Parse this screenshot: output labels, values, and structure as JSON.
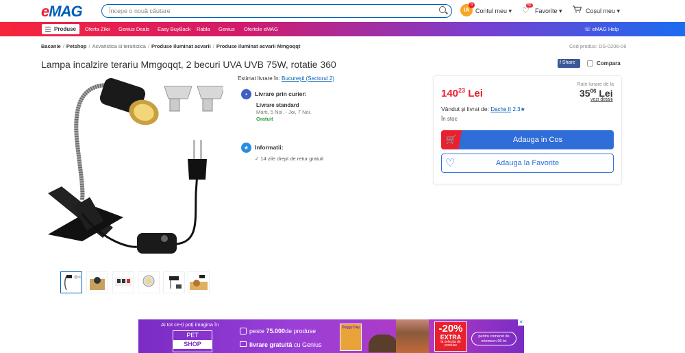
{
  "header": {
    "logo": {
      "e": "e",
      "mag": "MAG"
    },
    "search_placeholder": "Începe o nouă căutare",
    "avatar_initials": "IA",
    "avatar_badge": "8",
    "account_label": "Contul meu",
    "favorites_label": "Favorite",
    "favorites_badge": "56",
    "cart_label": "Coșul meu"
  },
  "nav": {
    "products": "Produse",
    "links": [
      "Oferta Zilei",
      "Genius Deals",
      "Easy BuyBack",
      "Rabla",
      "Genius",
      "Ofertele eMAG"
    ],
    "help": "eMAG Help"
  },
  "breadcrumb": [
    "Bacanie",
    "Petshop",
    "Acvaristica si teraristica",
    "Produse iluminat acvarii",
    "Produse iluminat acvarii Mmgoqqt"
  ],
  "product_code": "Cod produs: DS-0206-06",
  "title": "Lampa incalzire terariu Mmgoqqt, 2 becuri UVA UVB 75W, rotatie 360",
  "share": "Share",
  "compare": "Compara",
  "delivery": {
    "estim_label": "Estimat livrare în:",
    "estim_loc": "București (Sectorul 2)",
    "courier_title": "Livrare prin curier:",
    "standard": "Livrare standard",
    "dates": "Marti, 5 Noi. - Joi, 7 Noi.",
    "free": "Gratuit",
    "info_title": "Informatii:",
    "info_item": "14 zile drept de retur gratuit"
  },
  "price": {
    "int": "140",
    "dec": "23",
    "cur": "Lei",
    "rate_label": "Rate lunare de la",
    "rate_int": "35",
    "rate_dec": "06",
    "rate_cur": "Lei",
    "details": "vezi detalii",
    "seller_label": "Vândut și livrat de:",
    "seller": "Dache II",
    "seller_rating": "2.3",
    "stock": "În stoc",
    "add_cart": "Adauga in Cos",
    "add_fav": "Adauga la Favorite"
  },
  "banner": {
    "tagline": "Ai tot ce-ți poți imagina în",
    "pet": "PET",
    "shop": "SHOP",
    "line1_a": "peste ",
    "line1_b": "75.000",
    "line1_c": "de produse",
    "line2_a": "livrare gratuită",
    "line2_b": " cu Genius",
    "disc": "-20%",
    "extra": "EXTRA",
    "disc_note": "la selecția de produse",
    "note": "pentru comenzi de minimum 99 lei",
    "pack_text": "Doggy Day"
  },
  "colors": {
    "brand_red": "#e9212e",
    "brand_blue": "#005eb8",
    "button_blue": "#2f6ed9"
  }
}
